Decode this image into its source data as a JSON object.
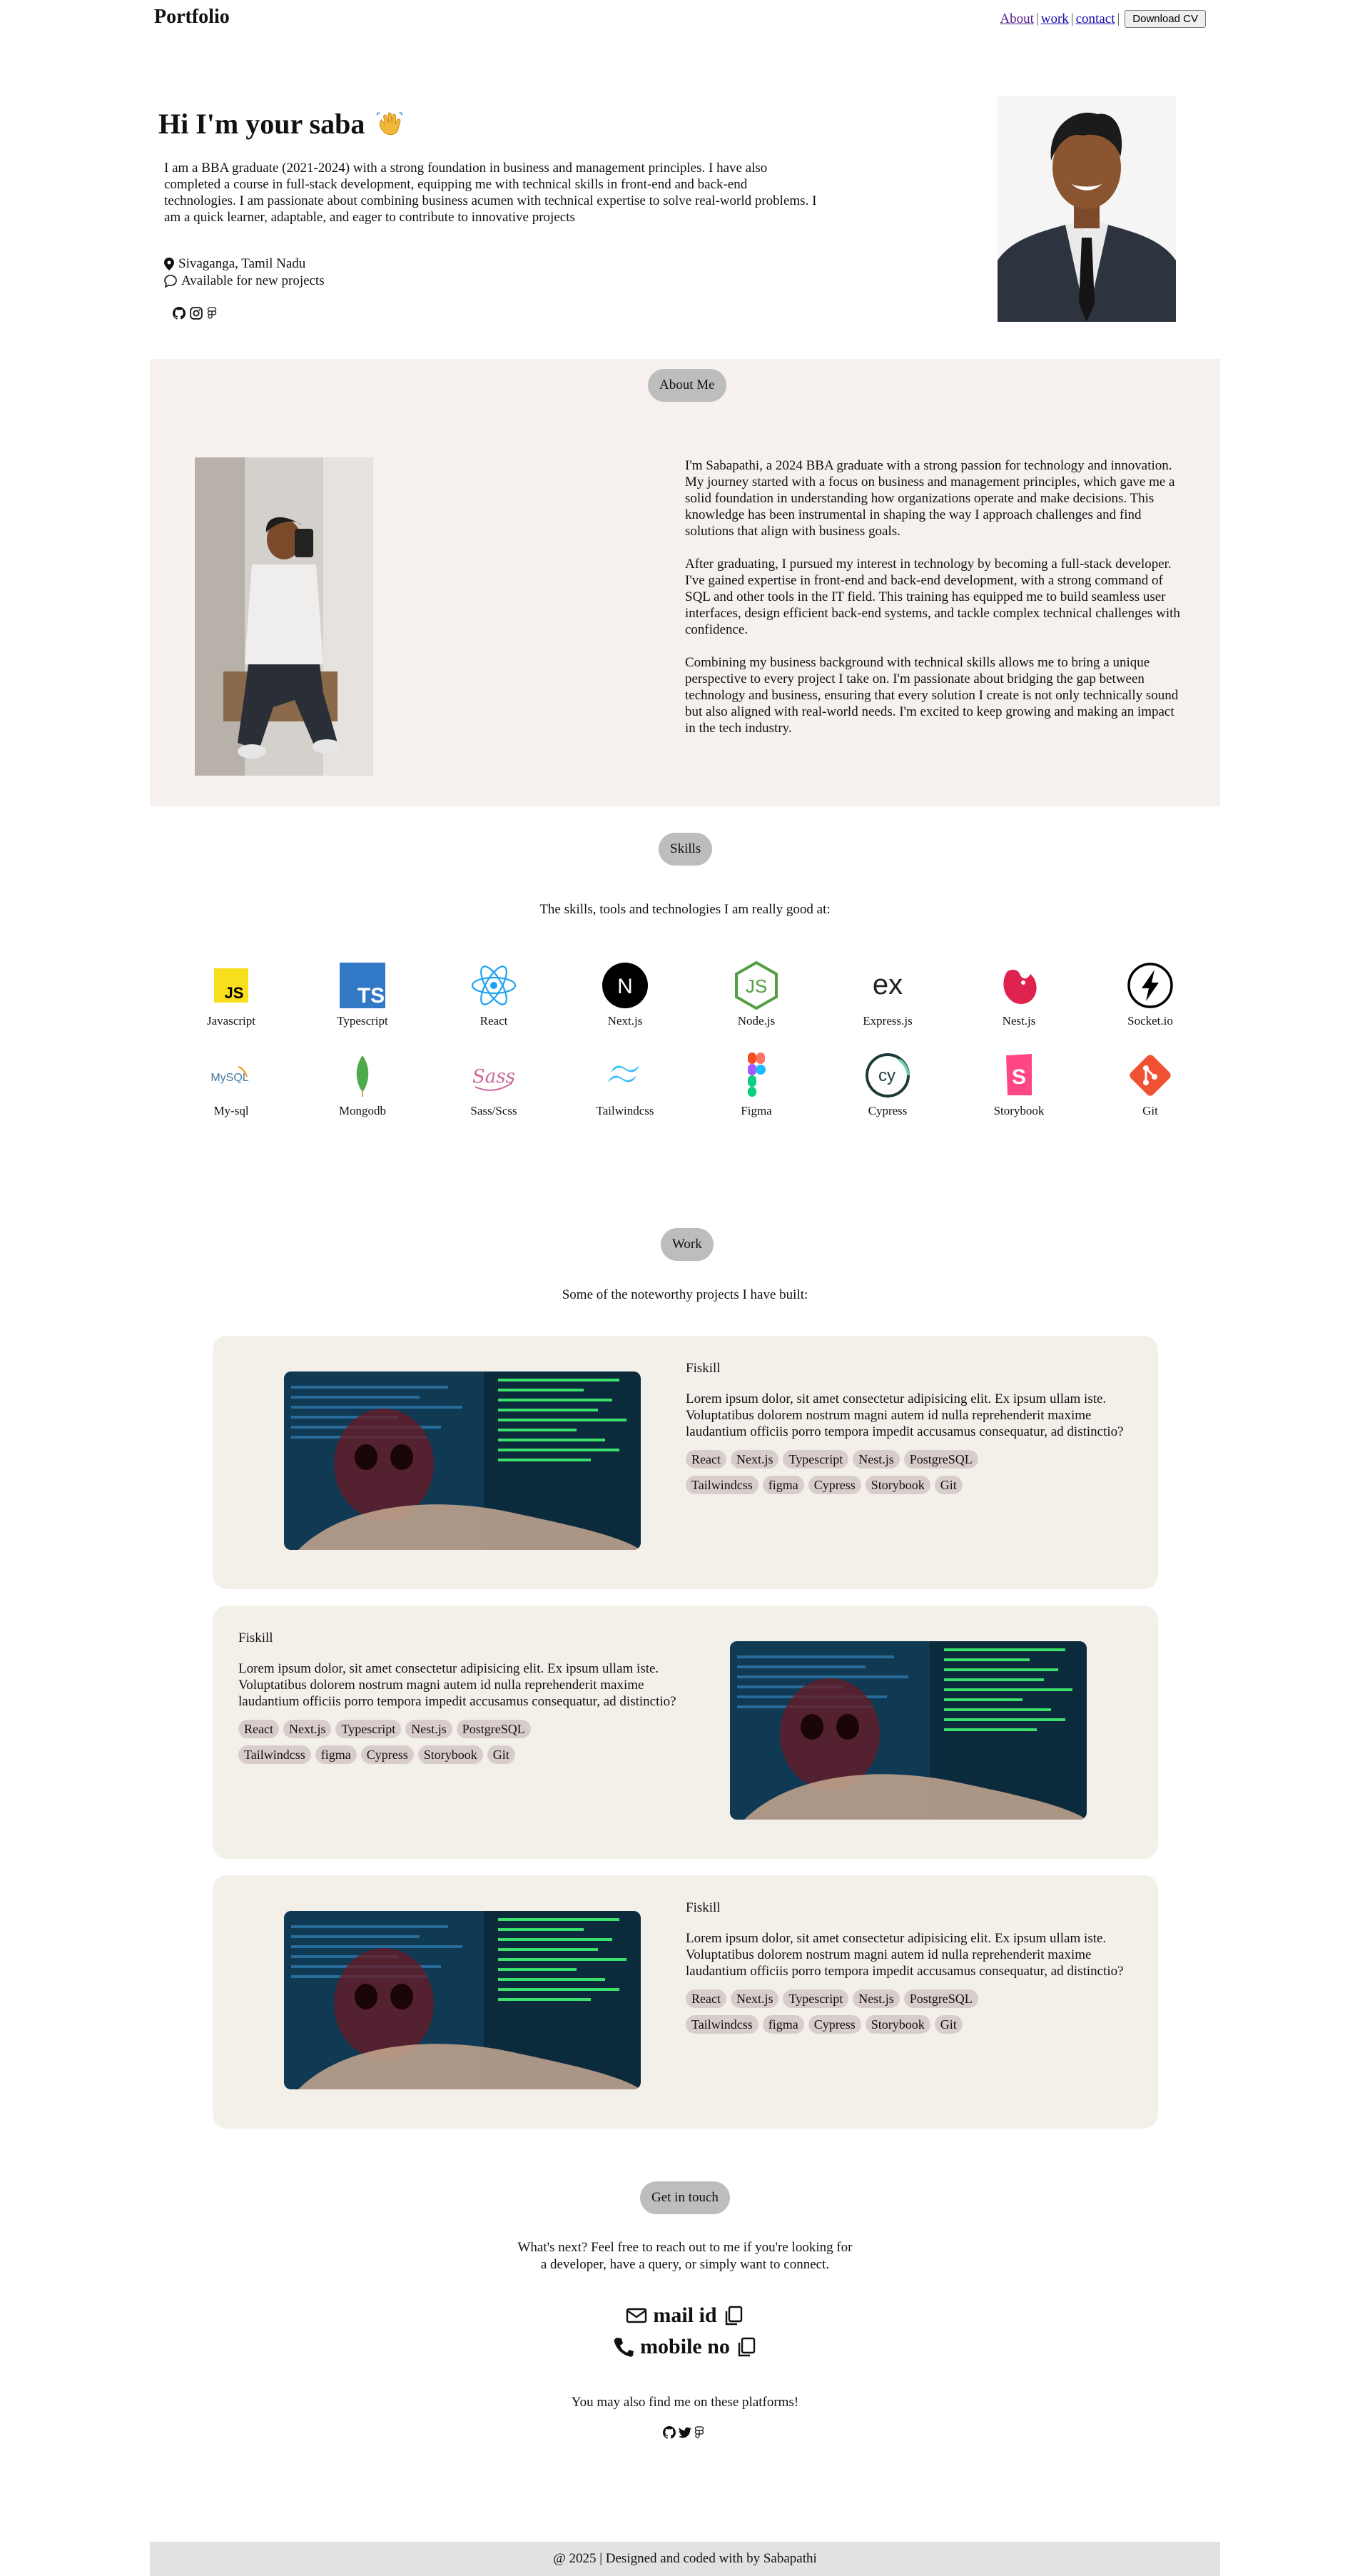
{
  "header": {
    "brand": "Portfolio",
    "nav": [
      {
        "label": "About"
      },
      {
        "label": "work"
      },
      {
        "label": "contact"
      }
    ],
    "separator": "|",
    "download_cv": "Download CV"
  },
  "hero": {
    "title": "Hi I'm your saba",
    "intro": "I am a BBA graduate (2021-2024) with a strong foundation in business and management principles. I have also completed a course in full-stack development, equipping me with technical skills in front-end and back-end technologies. I am passionate about combining business acumen with technical expertise to solve real-world problems. I am a quick learner, adaptable, and eager to contribute to innovative projects",
    "location": "Sivaganga, Tamil Nadu",
    "availability": "Available for new projects"
  },
  "about": {
    "pill": "About Me",
    "paragraphs": [
      "I'm Sabapathi, a 2024 BBA graduate with a strong passion for technology and innovation. My journey started with a focus on business and management principles, which gave me a solid foundation in understanding how organizations operate and make decisions. This knowledge has been instrumental in shaping the way I approach challenges and find solutions that align with business goals.",
      "After graduating, I pursued my interest in technology by becoming a full-stack developer. I've gained expertise in front-end and back-end development, with a strong command of SQL and other tools in the IT field. This training has equipped me to build seamless user interfaces, design efficient back-end systems, and tackle complex technical challenges with confidence.",
      "Combining my business background with technical skills allows me to bring a unique perspective to every project I take on. I'm passionate about bridging the gap between technology and business, ensuring that every solution I create is not only technically sound but also aligned with real-world needs. I'm excited to keep growing and making an impact in the tech industry."
    ]
  },
  "skills": {
    "pill": "Skills",
    "subtitle": "The skills, tools and technologies I am really good at:",
    "items": [
      {
        "label": "Javascript",
        "icon": "javascript-icon"
      },
      {
        "label": "Typescript",
        "icon": "typescript-icon"
      },
      {
        "label": "React",
        "icon": "react-icon"
      },
      {
        "label": "Next.js",
        "icon": "nextjs-icon"
      },
      {
        "label": "Node.js",
        "icon": "nodejs-icon"
      },
      {
        "label": "Express.js",
        "icon": "expressjs-icon"
      },
      {
        "label": "Nest.js",
        "icon": "nestjs-icon"
      },
      {
        "label": "Socket.io",
        "icon": "socketio-icon"
      },
      {
        "label": "My-sql",
        "icon": "mysql-icon"
      },
      {
        "label": "Mongodb",
        "icon": "mongodb-icon"
      },
      {
        "label": "Sass/Scss",
        "icon": "sass-icon"
      },
      {
        "label": "Tailwindcss",
        "icon": "tailwind-icon"
      },
      {
        "label": "Figma",
        "icon": "figma-icon"
      },
      {
        "label": "Cypress",
        "icon": "cypress-icon"
      },
      {
        "label": "Storybook",
        "icon": "storybook-icon"
      },
      {
        "label": "Git",
        "icon": "git-icon"
      }
    ],
    "icon_text": {
      "js": "JS",
      "ts": "TS",
      "next": "N",
      "node": "JS",
      "express": "ex",
      "mysql": "MySQL",
      "sass": "Sass",
      "cypress": "cy",
      "storybook": "S"
    }
  },
  "work": {
    "pill": "Work",
    "subtitle": "Some of the noteworthy projects I have built:",
    "projects": [
      {
        "title": "Fiskill",
        "description": "Lorem ipsum dolor, sit amet consectetur adipisicing elit. Ex ipsum ullam iste. Voluptatibus dolorem nostrum magni autem id nulla reprehenderit maxime laudantium officiis porro tempora impedit accusamus consequatur, ad distinctio?",
        "tags": [
          "React",
          "Next.js",
          "Typescript",
          "Nest.js",
          "PostgreSQL",
          "Tailwindcss",
          "figma",
          "Cypress",
          "Storybook",
          "Git"
        ]
      },
      {
        "title": "Fiskill",
        "description": "Lorem ipsum dolor, sit amet consectetur adipisicing elit. Ex ipsum ullam iste. Voluptatibus dolorem nostrum magni autem id nulla reprehenderit maxime laudantium officiis porro tempora impedit accusamus consequatur, ad distinctio?",
        "tags": [
          "React",
          "Next.js",
          "Typescript",
          "Nest.js",
          "PostgreSQL",
          "Tailwindcss",
          "figma",
          "Cypress",
          "Storybook",
          "Git"
        ]
      },
      {
        "title": "Fiskill",
        "description": "Lorem ipsum dolor, sit amet consectetur adipisicing elit. Ex ipsum ullam iste. Voluptatibus dolorem nostrum magni autem id nulla reprehenderit maxime laudantium officiis porro tempora impedit accusamus consequatur, ad distinctio?",
        "tags": [
          "React",
          "Next.js",
          "Typescript",
          "Nest.js",
          "PostgreSQL",
          "Tailwindcss",
          "figma",
          "Cypress",
          "Storybook",
          "Git"
        ]
      }
    ]
  },
  "contact": {
    "pill": "Get in touch",
    "line1": "What's next? Feel free to reach out to me if you're looking for",
    "line2": "a developer, have a query, or simply want to connect.",
    "mail": "mail id",
    "mobile": "mobile no",
    "platforms": "You may also find me on these platforms!"
  },
  "footer": {
    "text": "@ 2025 | Designed and coded with by Sabapathi"
  }
}
